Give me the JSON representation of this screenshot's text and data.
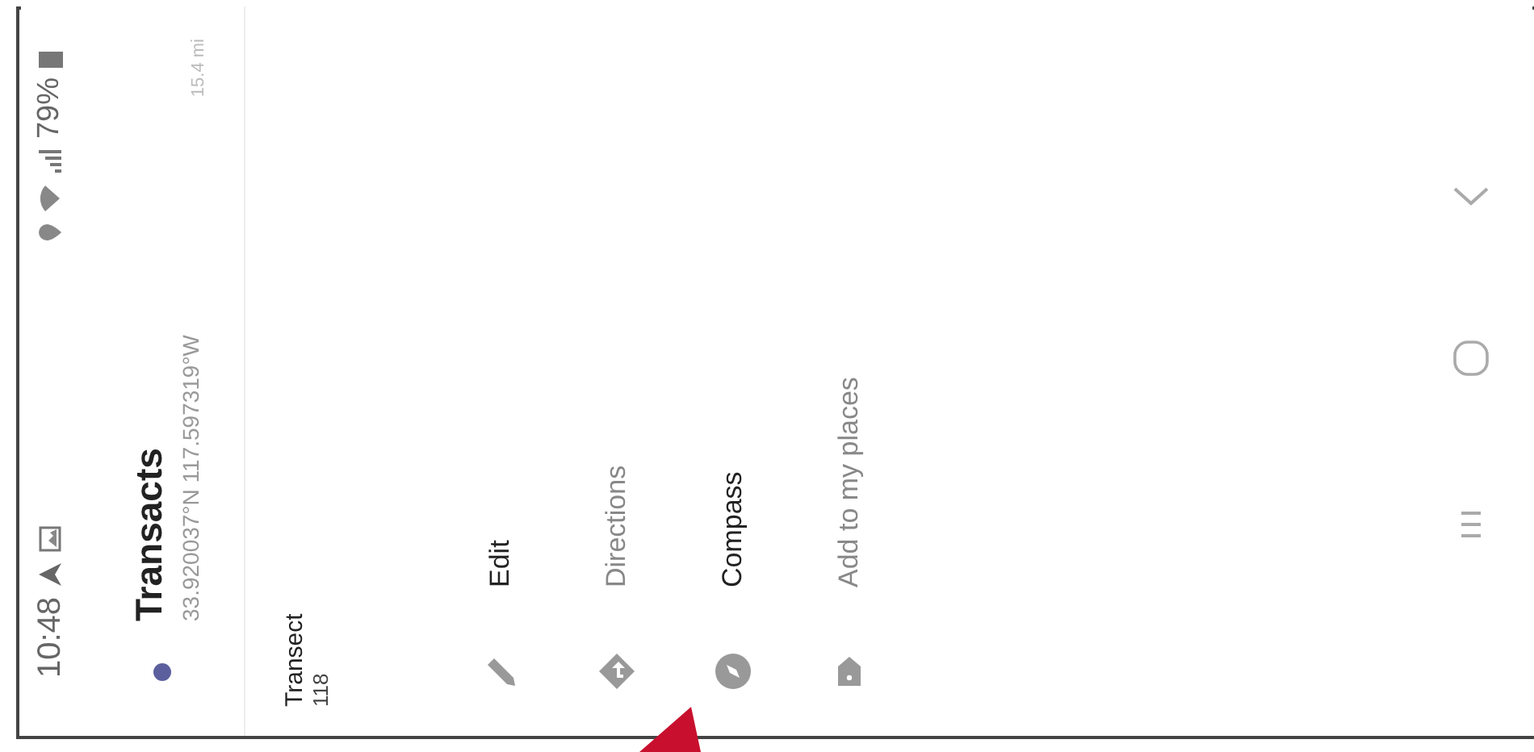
{
  "status_bar": {
    "time": "10:48",
    "battery": "79%"
  },
  "place": {
    "title": "Transacts",
    "coordinates": "33.920037°N 117.597319°W",
    "distance": "15.4 mi",
    "color": "#5b5f9e"
  },
  "note": {
    "name": "Transect",
    "value": "118"
  },
  "menu": [
    {
      "label": "Edit",
      "disabled": false
    },
    {
      "label": "Directions",
      "disabled": true
    },
    {
      "label": "Compass",
      "disabled": false
    },
    {
      "label": "Add to my places",
      "disabled": true
    }
  ]
}
